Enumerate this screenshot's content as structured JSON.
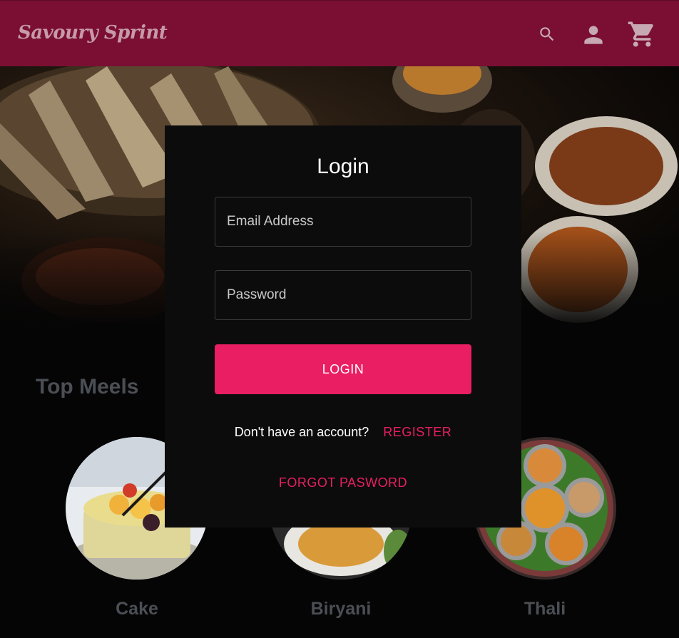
{
  "navbar": {
    "brand": "Savoury Sprint",
    "icons": [
      "search-icon",
      "account-icon",
      "cart-icon"
    ],
    "color": "#7a0f33"
  },
  "hero": {
    "description_icon": "food-photo"
  },
  "top_meals": {
    "title": "Top Meels",
    "items": [
      {
        "label": "Cake"
      },
      {
        "label": "Biryani"
      },
      {
        "label": "Thali"
      }
    ]
  },
  "login": {
    "title": "Login",
    "email_placeholder": "Email Address",
    "password_placeholder": "Password",
    "submit_label": "LOGIN",
    "register_prompt": "Don't have an account?",
    "register_link": "REGISTER",
    "forgot_link": "FORGOT PASWORD",
    "accent": "#e91e63"
  }
}
